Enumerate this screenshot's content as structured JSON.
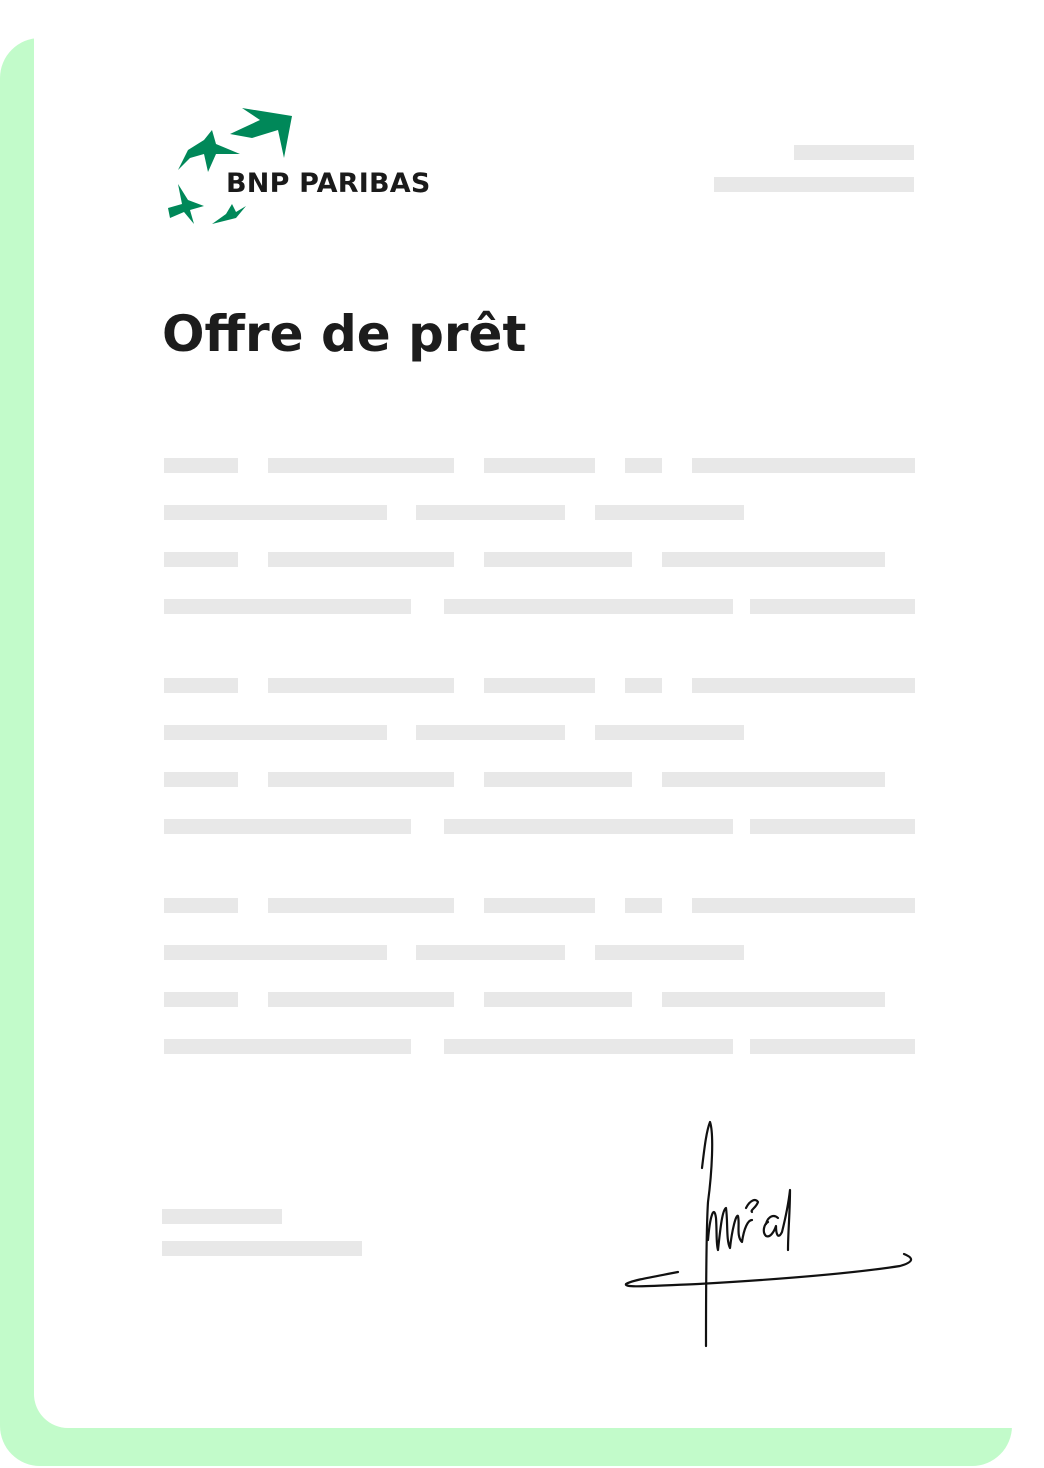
{
  "document": {
    "brand": {
      "name": "BNP PARIBAS",
      "logo_color": "#008859"
    },
    "title": "Offre de prêt",
    "placeholder_color": "#e8e8e8",
    "accent_color": "#c2fbca",
    "signature_icon": "handwritten-signature"
  }
}
